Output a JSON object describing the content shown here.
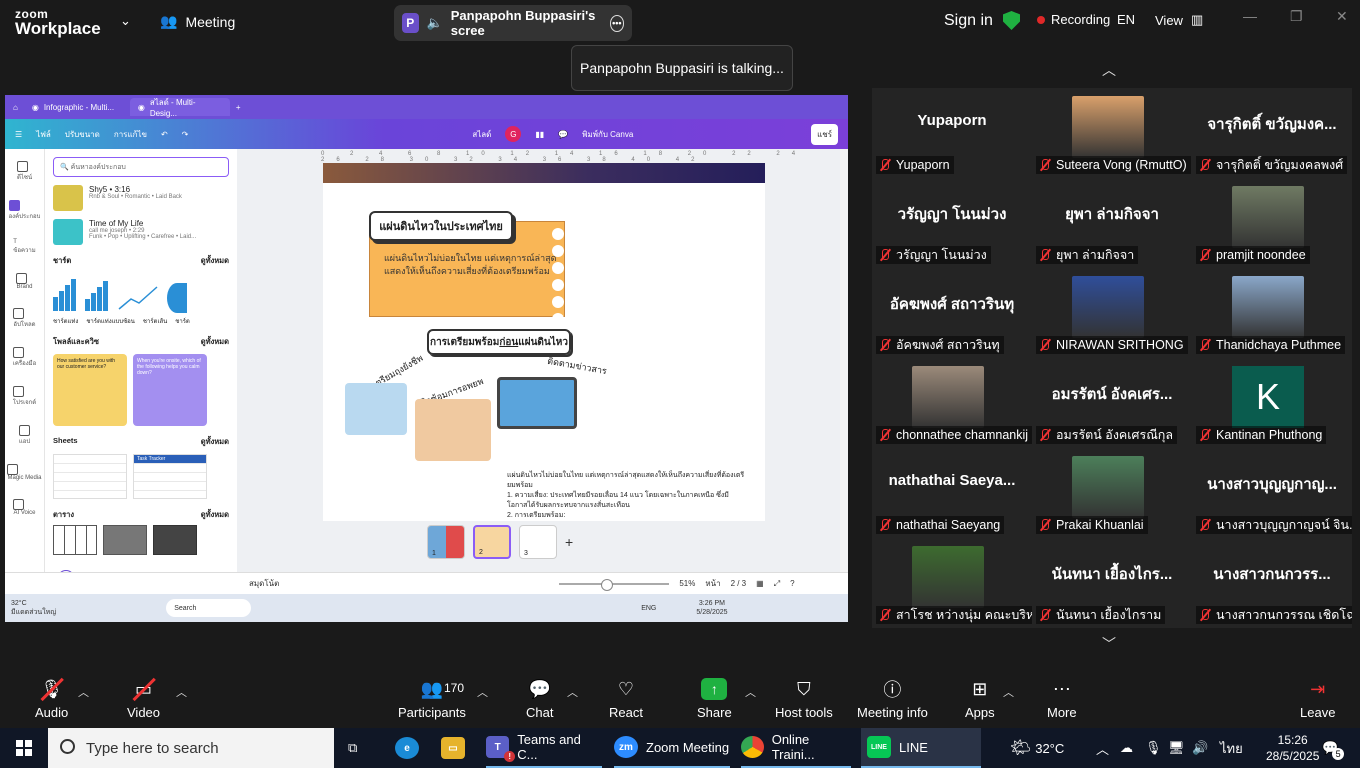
{
  "zoom_header": {
    "logo_line1": "zoom",
    "logo_line2": "Workplace",
    "meeting_label": "Meeting",
    "sharer_badge": "P",
    "sharer_label": "Panpapohn Buppasiri's scree",
    "sign_in": "Sign in",
    "recording": "Recording",
    "language": "EN",
    "view": "View"
  },
  "talking_tooltip": "Panpapohn Buppasiri is talking...",
  "shared_screen": {
    "browser_tabs": [
      "Infographic - Multi...",
      "สไลด์ - Multi-Desig..."
    ],
    "canva_menu": [
      "ไฟล์",
      "ปรับขนาด",
      "การแก้ไข"
    ],
    "canva_right": [
      "สไลด์",
      "G",
      "พิมพ์กับ Canva",
      "แชร์"
    ],
    "search_placeholder": "ค้นหาองค์ประกอบ",
    "songs": [
      {
        "title": "Shy5 • 3:16",
        "sub": "Rnb & Soul • Romantic • Laid Back"
      },
      {
        "title": "Time of My Life",
        "sub": "call me joseph • 2:29",
        "sub2": "Funk • Pop • Uplifting • Carefree • Laid..."
      }
    ],
    "rail_items": [
      "ดีไซน์",
      "องค์ประกอบ",
      "ข้อความ",
      "Brand",
      "อัปโหลด",
      "เครื่องมือ",
      "โปรเจกต์",
      "แอป",
      "Magic Media",
      "AI Voice"
    ],
    "section_charts": "ชาร์ต",
    "see_all": "ดูทั้งหมด",
    "chart_names": [
      "ชาร์ตแท่ง",
      "ชาร์ตแท่งแบบซ้อน",
      "ชาร์ตเส้น",
      "ชาร์ต"
    ],
    "section_forms": "โพลล์และควิซ",
    "card1_text": "How satisfied are you with our customer service?",
    "card2_text": "When you're onsite, which of the following helps you calm down?",
    "section_sheets": "Sheets",
    "sheet2_title": "Task Tracker",
    "section_tables": "ตาราง",
    "slide_title": "แผ่นดินไหวในประเทศไทย",
    "slide_body": "แผ่นดินไหวไม่บ่อยในไทย แต่เหตุการณ์ล่าสุด แสดงให้เห็นถึงความเสี่ยงที่ต้องเตรียมพร้อม",
    "prep_title_a": "การเตรียมพร้อม",
    "prep_title_b": "ก่อน",
    "prep_title_c": "แผ่นดินไหว",
    "arc1": "จัดเตรียมถุงยังชีพ",
    "arc2": "ฝึกซ้อมการอพยพ",
    "arc3": "ติดตามข่าวสาร",
    "bottom_para": "แผ่นดินไหวไม่บ่อยในไทย แต่เหตุการณ์ล่าสุดแสดงให้เห็นถึงความเสี่ยงที่ต้องเตรียมพร้อม",
    "bottom_item1": "1. ความเสี่ยง: ประเทศไทยมีรอยเลื่อน 14 แนว โดยเฉพาะในภาคเหนือ ซึ่งมีโอกาสได้รับผลกระทบจากแรงสั่นสะเทือน",
    "bottom_item2": "2. การเตรียมพร้อม:",
    "page_nums": [
      "1",
      "2",
      "3"
    ],
    "foot_notes": "สมุดโน้ต",
    "zoom_pct": "51%",
    "page_label": "หน้า",
    "page_count": "2 / 3",
    "weather_temp": "32°C",
    "weather_text": "มีแดดส่วนใหญ่",
    "mini_search": "Search",
    "mini_time": "3:26 PM",
    "mini_date": "5/28/2025",
    "mini_lang": "ENG"
  },
  "participants": [
    {
      "display": "Yupaporn",
      "label": "Yupaporn",
      "type": "name"
    },
    {
      "display": "",
      "label": "Suteera Vong (RmuttO)",
      "type": "photo",
      "color": "#d9a06b"
    },
    {
      "display": "จารุกิตติ์ ขวัญมงค...",
      "label": "จารุกิตติ์ ขวัญมงคลพงศ์",
      "type": "name"
    },
    {
      "display": "วรัญญา โนนม่วง",
      "label": "วรัญญา โนนม่วง",
      "type": "name"
    },
    {
      "display": "ยุพา ล่ามกิจจา",
      "label": "ยุพา ล่ามกิจจา",
      "type": "name"
    },
    {
      "display": "",
      "label": "pramjit noondee",
      "type": "photo",
      "color": "#6f7a63"
    },
    {
      "display": "อัคฆพงศ์ สถาวรินทุ",
      "label": "อัคฆพงศ์ สถาวรินทุ",
      "type": "name"
    },
    {
      "display": "",
      "label": "NIRAWAN SRITHONG",
      "type": "photo",
      "color": "#2f4e9a"
    },
    {
      "display": "",
      "label": "Thanidchaya Puthmee",
      "type": "photo",
      "color": "#8aa7c9"
    },
    {
      "display": "",
      "label": "chonnathee chamnankij",
      "type": "photo",
      "color": "#9b8a7a"
    },
    {
      "display": "อมรรัตน์ อังคเศร...",
      "label": "อมรรัตน์ อังคเศรณีกุล",
      "type": "name"
    },
    {
      "display": "K",
      "label": "Kantinan Phuthong",
      "type": "letter"
    },
    {
      "display": "nathathai  Saeya...",
      "label": "nathathai Saeyang",
      "type": "name"
    },
    {
      "display": "",
      "label": "Prakai Khuanlai",
      "type": "photo",
      "color": "#4c7f5a"
    },
    {
      "display": "นางสาวบุญญกาญ...",
      "label": "นางสาวบุญญกาญจน์ จิน...",
      "type": "name"
    },
    {
      "display": "",
      "label": "สาโรช หว่างนุ่ม คณะบริห...",
      "type": "photo",
      "color": "#3d6b2f"
    },
    {
      "display": "นันทนา เยื้องไกร...",
      "label": "นันทนา เยื้องไกราม",
      "type": "name"
    },
    {
      "display": "นางสาวกนกวรร...",
      "label": "นางสาวกนกวรรณ เชิดโฉ...",
      "type": "name"
    }
  ],
  "toolbar": {
    "audio": "Audio",
    "video": "Video",
    "participants": "Participants",
    "participant_count": "170",
    "chat": "Chat",
    "react": "React",
    "share": "Share",
    "host_tools": "Host tools",
    "meeting_info": "Meeting info",
    "apps": "Apps",
    "more": "More",
    "leave": "Leave"
  },
  "taskbar": {
    "search_placeholder": "Type here to search",
    "teams": "Teams and C...",
    "zoom": "Zoom Meeting",
    "chrome": "Online Traini...",
    "line": "LINE",
    "temp": "32°C",
    "lang": "ไทย",
    "time": "15:26",
    "date": "28/5/2025",
    "notif_count": "5",
    "teams_badge": "!"
  },
  "colors": {
    "zoom_bg": "#1a1a1a",
    "recording_red": "#e02828",
    "share_green": "#1fb141",
    "canva_purple": "#6d4fd6",
    "slide_orange": "#f9b656"
  }
}
